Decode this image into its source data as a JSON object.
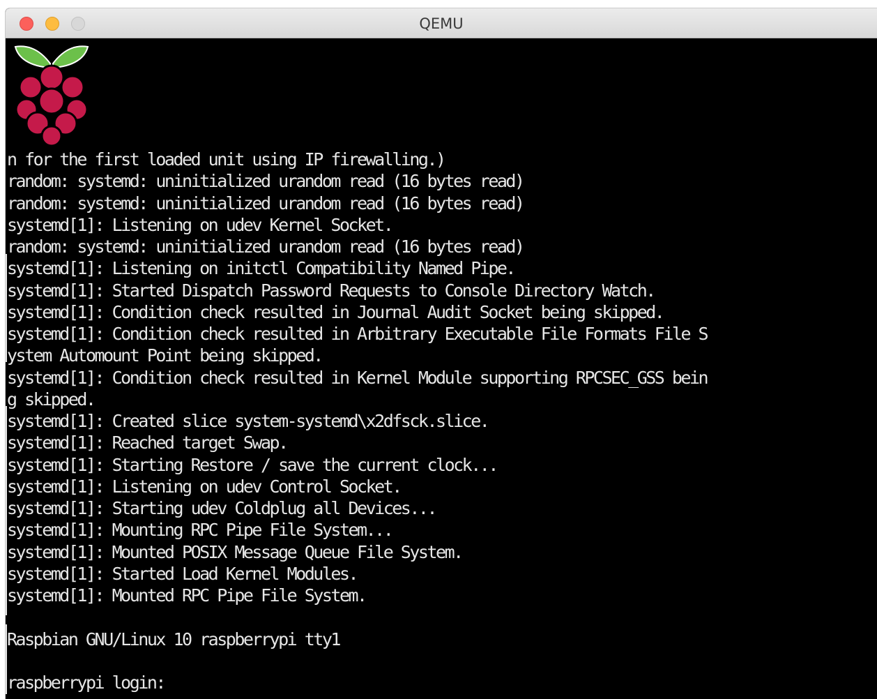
{
  "window": {
    "title": "QEMU"
  },
  "colors": {
    "close": "#fc605b",
    "minimize": "#fdbc40",
    "maximize": "#d8d8d8",
    "console_bg": "#000000",
    "console_fg": "#e6e6e6",
    "logo_leaf": "#6cc04a",
    "logo_berry": "#c51a4a"
  },
  "console": {
    "lines": [
      "n for the first loaded unit using IP firewalling.)",
      "random: systemd: uninitialized urandom read (16 bytes read)",
      "random: systemd: uninitialized urandom read (16 bytes read)",
      "systemd[1]: Listening on udev Kernel Socket.",
      "random: systemd: uninitialized urandom read (16 bytes read)",
      "systemd[1]: Listening on initctl Compatibility Named Pipe.",
      "systemd[1]: Started Dispatch Password Requests to Console Directory Watch.",
      "systemd[1]: Condition check resulted in Journal Audit Socket being skipped.",
      "systemd[1]: Condition check resulted in Arbitrary Executable File Formats File S",
      "ystem Automount Point being skipped.",
      "systemd[1]: Condition check resulted in Kernel Module supporting RPCSEC_GSS bein",
      "g skipped.",
      "systemd[1]: Created slice system-systemd\\x2dfsck.slice.",
      "systemd[1]: Reached target Swap.",
      "systemd[1]: Starting Restore / save the current clock...",
      "systemd[1]: Listening on udev Control Socket.",
      "systemd[1]: Starting udev Coldplug all Devices...",
      "systemd[1]: Mounting RPC Pipe File System...",
      "systemd[1]: Mounted POSIX Message Queue File System.",
      "systemd[1]: Started Load Kernel Modules.",
      "systemd[1]: Mounted RPC Pipe File System.",
      "",
      "Raspbian GNU/Linux 10 raspberrypi tty1",
      "",
      "raspberrypi login:"
    ]
  }
}
